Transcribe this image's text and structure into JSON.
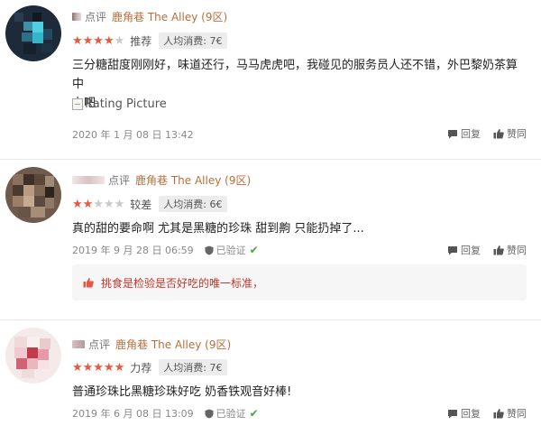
{
  "colors": {
    "star_on": "#e9593d",
    "star_off": "#c9c9c9",
    "shop": "#b86e3b",
    "verified": "#4aa54a"
  },
  "reviews": [
    {
      "label": "点评",
      "shop": "鹿角巷 The Alley (9区)",
      "rating": 4,
      "rating_word": "推荐",
      "price": "人均消费: 7€",
      "text_line1": "三分糖甜度刚刚好，味道还行，马马虎虎吧，我碰见的服务员人还不错，外巴黎奶茶算中",
      "text_line2": "上吧",
      "picture_alt": "Rating Picture",
      "date": "2020 年 1 月 08 日 13:42",
      "reply": "回复",
      "like": "赞同"
    },
    {
      "label": "点评",
      "shop": "鹿角巷 The Alley (9区)",
      "rating": 2,
      "rating_word": "较差",
      "price": "人均消费: 6€",
      "text_line1": "真的甜的要命啊 尤其是黑糖的珍珠 甜到齁 只能扔掉了...",
      "date": "2019 年 9 月 28 日 06:59",
      "verified": "已验证",
      "reply": "回复",
      "like": "赞同",
      "shop_reply": "挑食是检验是否好吃的唯一标准，"
    },
    {
      "label": "点评",
      "shop": "鹿角巷 The Alley (9区)",
      "rating": 5,
      "rating_word": "力荐",
      "price": "人均消费: 7€",
      "text_line1": "普通珍珠比黑糖珍珠好吃 奶香铁观音好棒!",
      "date": "2019 年 6 月 08 日 13:09",
      "verified": "已验证",
      "reply": "回复",
      "like": "赞同"
    }
  ]
}
